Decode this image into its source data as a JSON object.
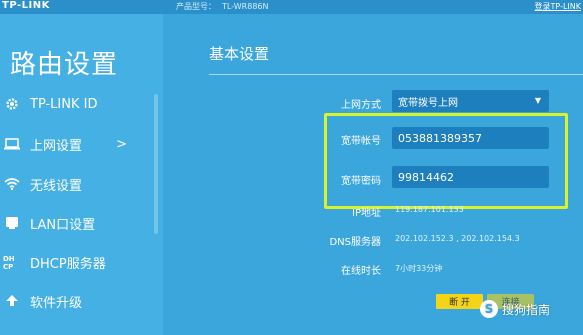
{
  "header": {
    "brand": "TP-LINK",
    "model_label": "产品型号：",
    "model_value": "TL-WR886N",
    "logout": "登录TP-LINK"
  },
  "sidebar": {
    "title": "路由设置",
    "items": [
      {
        "label": "TP-LINK ID",
        "icon": "gear-icon"
      },
      {
        "label": "上网设置",
        "icon": "laptop-icon",
        "arrow": ">"
      },
      {
        "label": "无线设置",
        "icon": "wifi-icon"
      },
      {
        "label": "LAN口设置",
        "icon": "network-icon"
      },
      {
        "label": "DHCP服务器",
        "icon": "dhcp-icon"
      },
      {
        "label": "软件升级",
        "icon": "upload-icon"
      }
    ]
  },
  "main": {
    "title": "基本设置",
    "connection_type_label": "上网方式",
    "connection_type_value": "宽带拨号上网",
    "account_label": "宽带帐号",
    "account_value": "053881389357",
    "password_label": "宽带密码",
    "password_value": "99814462",
    "ip_label": "IP地址",
    "ip_value": "119.187.101.133",
    "dns_label": "DNS服务器",
    "dns_value": "202.102.152.3 , 202.102.154.3",
    "online_label": "在线时长",
    "online_value": "7小时33分钟",
    "connect_button": "断 开",
    "save_button": "连接"
  },
  "watermark": {
    "text": "搜狗指南",
    "logo_char": "S"
  },
  "colors": {
    "background": "#3aa6dc",
    "sidebar": "#45b0e4",
    "field": "#1d7fbe",
    "highlight": "#d9f22a",
    "button": "#f3d417"
  }
}
